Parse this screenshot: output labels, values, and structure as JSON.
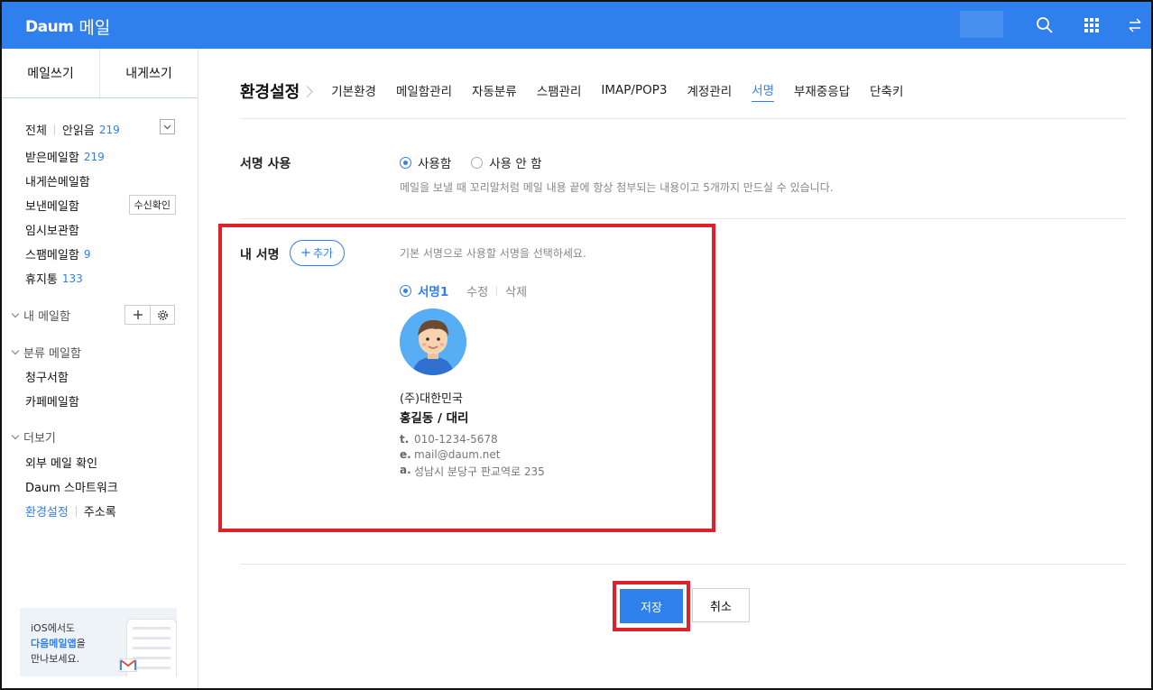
{
  "header": {
    "brand": "Daum",
    "title": "메일",
    "icons": [
      "search-icon",
      "apps-grid-icon",
      "switch-icon"
    ],
    "bg_color": "#2f80ed"
  },
  "sidebar": {
    "compose_label": "메일쓰기",
    "self_compose_label": "내게쓰기",
    "filter": {
      "all_label": "전체",
      "unread_label": "안읽음",
      "unread_count": "219"
    },
    "mailboxes": [
      {
        "label": "받은메일함",
        "count": "219"
      },
      {
        "label": "내게쓴메일함",
        "count": ""
      },
      {
        "label": "보낸메일함",
        "count": "",
        "button": "수신확인"
      },
      {
        "label": "임시보관함",
        "count": ""
      },
      {
        "label": "스팸메일함",
        "count": "9"
      },
      {
        "label": "휴지통",
        "count": "133"
      }
    ],
    "my_mailbox_label": "내 메일함",
    "category_label": "분류 메일함",
    "category_items": [
      "청구서함",
      "카페메일함"
    ],
    "more_label": "더보기",
    "more_items": [
      "외부 메일 확인",
      "Daum 스마트워크"
    ],
    "settings_label": "환경설정",
    "contacts_label": "주소록",
    "promo": {
      "line1": "iOS에서도",
      "line2_bold": "다음메일앱",
      "line2_rest": "을",
      "line3": "만나보세요."
    }
  },
  "main": {
    "settings_title": "환경설정",
    "tabs": [
      "기본환경",
      "메일함관리",
      "자동분류",
      "스팸관리",
      "IMAP/POP3",
      "계정관리",
      "서명",
      "부재중응답",
      "단축키"
    ],
    "active_tab": "서명",
    "signature_use": {
      "label": "서명 사용",
      "option_on": "사용함",
      "option_off": "사용 안 함",
      "selected": "on",
      "description": "메일을 보낼 때 꼬리말처럼 메일 내용 끝에 항상 첨부되는 내용이고 5개까지 만드실 수 있습니다."
    },
    "my_signature": {
      "label": "내 서명",
      "add_label": "추가",
      "hint": "기본 서명으로 사용할 서명을 선택하세요.",
      "signature_name": "서명1",
      "edit_label": "수정",
      "delete_label": "삭제",
      "company": "(주)대한민국",
      "person": "홍길동 / 대리",
      "phone_key": "t.",
      "phone": "010-1234-5678",
      "email_key": "e.",
      "email": "mail@daum.net",
      "address_key": "a.",
      "address": "성남시 분당구 판교역로 235"
    },
    "save_label": "저장",
    "cancel_label": "취소"
  }
}
